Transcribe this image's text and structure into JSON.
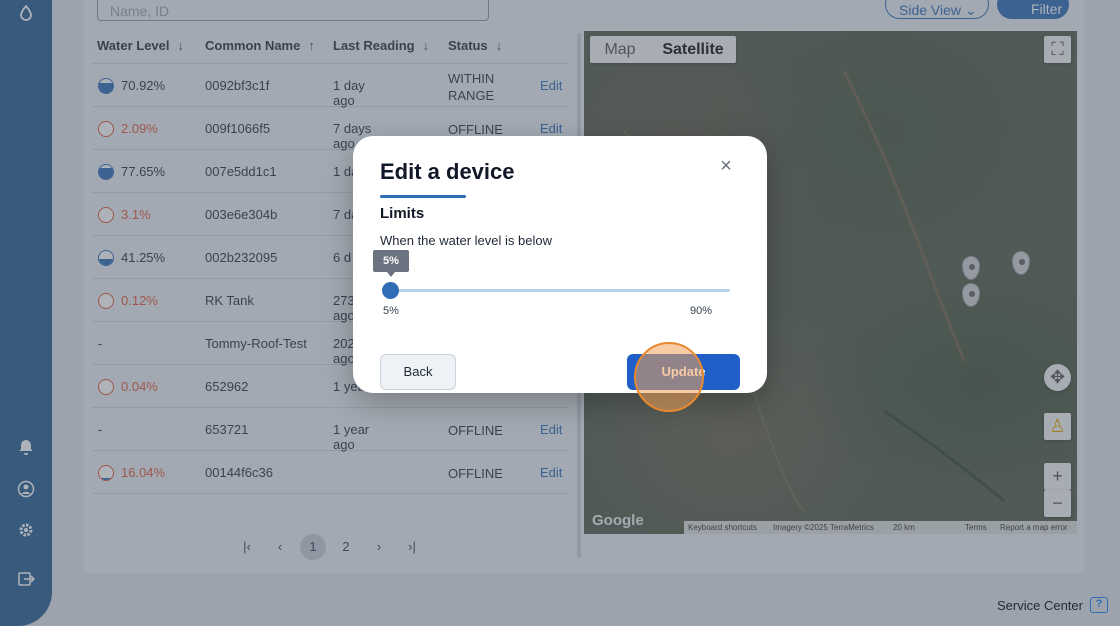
{
  "search": {
    "placeholder": "Name, ID"
  },
  "toolbar": {
    "side_view_label": "Side View",
    "filter_label": "Filter"
  },
  "table": {
    "headers": [
      "Water Level",
      "Common Name",
      "Last Reading",
      "Status"
    ],
    "rows": [
      {
        "level": "70.92%",
        "fill": 0.71,
        "low": false,
        "name": "0092bf3c1f",
        "reading": "1 day ago",
        "status": "WITHIN RANGE",
        "edit": "Edit"
      },
      {
        "level": "2.09%",
        "fill": 0.02,
        "low": true,
        "name": "009f1066f5",
        "reading": "7 days ago",
        "status": "OFFLINE",
        "edit": "Edit"
      },
      {
        "level": "77.65%",
        "fill": 0.78,
        "low": false,
        "name": "007e5dd1c1",
        "reading": "1 da",
        "status": "",
        "edit": ""
      },
      {
        "level": "3.1%",
        "fill": 0.03,
        "low": true,
        "name": "003e6e304b",
        "reading": "7 da",
        "status": "",
        "edit": ""
      },
      {
        "level": "41.25%",
        "fill": 0.41,
        "low": false,
        "name": "002b232095",
        "reading": "6 d",
        "status": "",
        "edit": ""
      },
      {
        "level": "0.12%",
        "fill": 0.0,
        "low": true,
        "name": "RK Tank",
        "reading": "273 ago",
        "status": "",
        "edit": ""
      },
      {
        "level": "-",
        "fill": null,
        "low": false,
        "name": "Tommy-Roof-Test",
        "reading": "202 ago",
        "status": "",
        "edit": ""
      },
      {
        "level": "0.04%",
        "fill": 0.0,
        "low": true,
        "name": "652962",
        "reading": "1 yea",
        "status": "",
        "edit": ""
      },
      {
        "level": "-",
        "fill": null,
        "low": false,
        "name": "653721",
        "reading": "1 year ago",
        "status": "OFFLINE",
        "edit": "Edit"
      },
      {
        "level": "16.04%",
        "fill": 0.16,
        "low": true,
        "name": "00144f6c36",
        "reading": "",
        "status": "OFFLINE",
        "edit": "Edit"
      }
    ]
  },
  "pagination": {
    "pages": [
      "1",
      "2"
    ],
    "current": "1"
  },
  "map": {
    "tabs": [
      "Map",
      "Satellite"
    ],
    "brand": "Google",
    "footer": [
      "Keyboard shortcuts",
      "Imagery ©2025 TerraMetrics",
      "20 km",
      "Terms",
      "Report a map error"
    ]
  },
  "modal": {
    "title": "Edit a device",
    "section": "Limits",
    "description": "When the water level is below",
    "tooltip": "5%",
    "value": 5,
    "min_label": "5%",
    "max_label": "90%",
    "back_label": "Back",
    "update_label": "Update"
  },
  "footer": {
    "service_center": "Service Center"
  },
  "colors": {
    "primary": "#2f6db6",
    "sidebar": "#285f90",
    "alert": "#e05a3a"
  }
}
